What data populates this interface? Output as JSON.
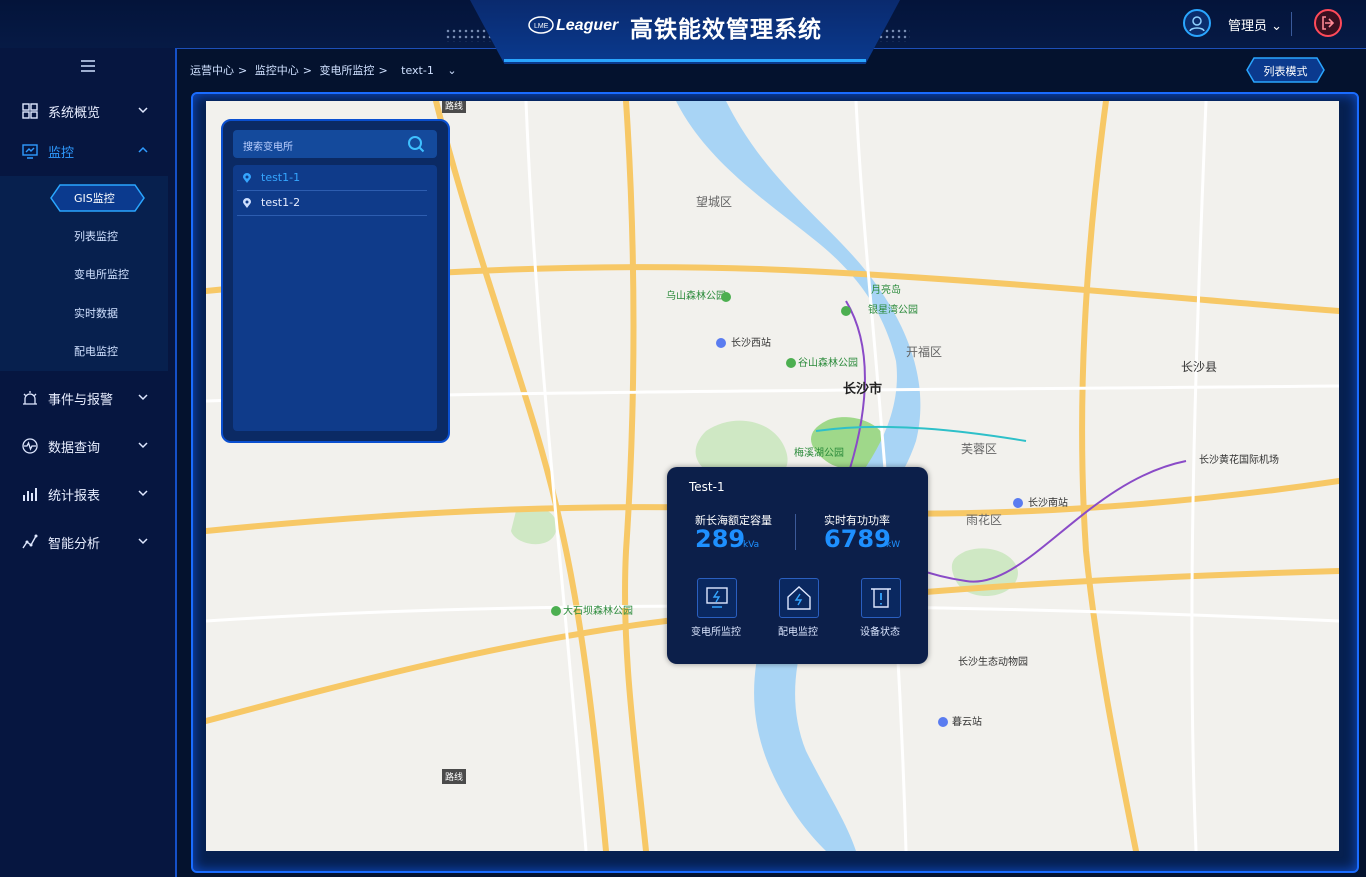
{
  "header": {
    "logo_text": "Leaguer",
    "app_title": "高铁能效管理系统",
    "user_label": "管理员"
  },
  "sidebar": {
    "items": [
      {
        "label": "系统概览",
        "icon": "grid-icon"
      },
      {
        "label": "监控",
        "icon": "monitor-icon",
        "active": true
      },
      {
        "label": "事件与报警",
        "icon": "alarm-icon"
      },
      {
        "label": "数据查询",
        "icon": "pulse-icon"
      },
      {
        "label": "统计报表",
        "icon": "bar-chart-icon"
      },
      {
        "label": "智能分析",
        "icon": "analysis-icon"
      }
    ],
    "submenu": [
      {
        "label": "GIS监控",
        "active": true
      },
      {
        "label": "列表监控"
      },
      {
        "label": "变电所监控"
      },
      {
        "label": "实时数据"
      },
      {
        "label": "配电监控"
      }
    ]
  },
  "breadcrumb": {
    "items": [
      "运营中心",
      "监控中心",
      "变电所监控"
    ],
    "current": "text-1"
  },
  "toolbar": {
    "list_mode_label": "列表模式"
  },
  "station_panel": {
    "search_placeholder": "搜索变电所",
    "stations": [
      {
        "name": "test1-1",
        "selected": true
      },
      {
        "name": "test1-2",
        "selected": false
      }
    ]
  },
  "map": {
    "city_labels": [
      "长沙市",
      "长沙县",
      "开福区",
      "芙蓉区",
      "雨花区",
      "望城区"
    ],
    "place_labels": [
      "长沙西站",
      "长沙南站",
      "长沙黄花国际机场",
      "暮云站",
      "乌山森林公园",
      "谷山森林公园",
      "大石坝森林公园",
      "长沙生态动物园",
      "梅溪湖公园",
      "银星湾公园",
      "月亮岛"
    ],
    "road_badge": "路线"
  },
  "popup": {
    "title": "Test-1",
    "metric1_label": "新长海额定容量",
    "metric1_value": "289",
    "metric1_unit": "kVa",
    "metric2_label": "实时有功功率",
    "metric2_value": "6789",
    "metric2_unit": "kW",
    "actions": [
      "变电所监控",
      "配电监控",
      "设备状态"
    ]
  },
  "colors": {
    "accent": "#1e90ff",
    "frame": "#1a6cff",
    "sidebar_bg": "#061640",
    "page_bg": "#04122e"
  }
}
